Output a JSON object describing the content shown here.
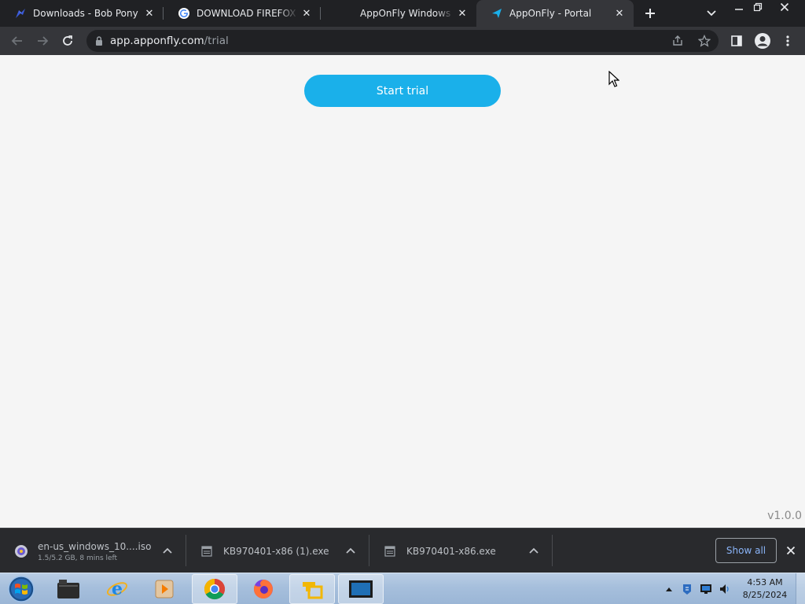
{
  "tabs": [
    {
      "title": "Downloads - Bob Pony",
      "favicon": "bobpony-icon"
    },
    {
      "title": "DOWNLOAD FIREFOX FO",
      "favicon": "google-icon"
    },
    {
      "title": "AppOnFly Windows VPS",
      "favicon": "none"
    },
    {
      "title": "AppOnFly - Portal",
      "favicon": "apponfly-icon",
      "active": true
    }
  ],
  "omnibox": {
    "domain": "app.apponfly.com",
    "path": "/trial"
  },
  "page": {
    "cta_label": "Start trial",
    "version": "v1.0.0",
    "accent_color": "#1ab0ea"
  },
  "downloads": {
    "items": [
      {
        "name": "en-us_windows_10....iso",
        "status": "1.5/5.2 GB, 8 mins left",
        "icon": "disc-image-icon"
      },
      {
        "name": "KB970401-x86 (1).exe",
        "status": "",
        "icon": "exe-file-icon"
      },
      {
        "name": "KB970401-x86.exe",
        "status": "",
        "icon": "exe-file-icon"
      }
    ],
    "show_all_label": "Show all"
  },
  "taskbar": {
    "apps": [
      "explorer-libraries",
      "internet-explorer",
      "media-player",
      "chrome",
      "firefox",
      "vmware",
      "remote-desktop"
    ],
    "clock": {
      "time": "4:53 AM",
      "date": "8/25/2024"
    }
  }
}
